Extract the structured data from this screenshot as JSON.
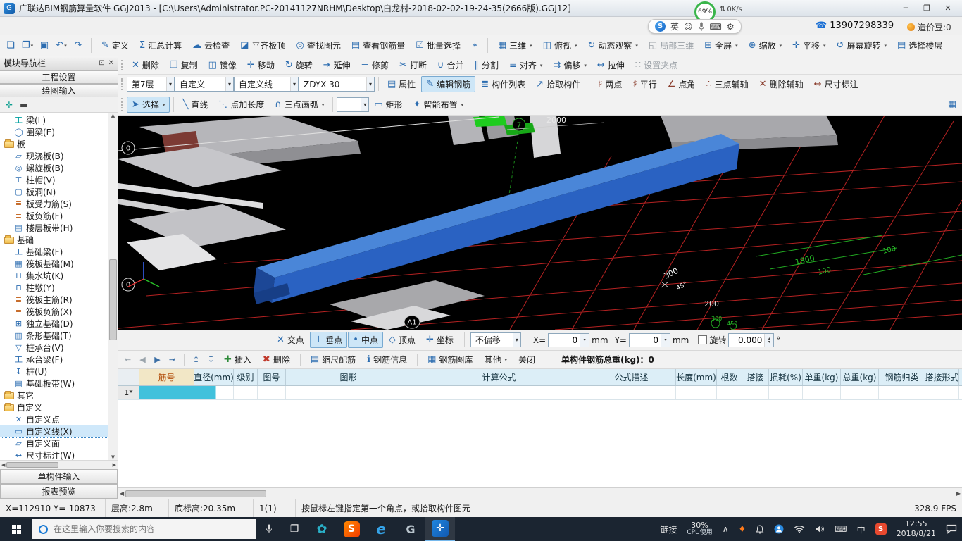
{
  "titlebar": {
    "app_glyph": "G",
    "title": "广联达BIM钢筋算量软件 GGJ2013 - [C:\\Users\\Administrator.PC-20141127NRHM\\Desktop\\白龙村-2018-02-02-19-24-35(2666版).GGJ12]",
    "minimize": "─",
    "maximize": "❐",
    "close": "✕"
  },
  "account_bar": {
    "battery": "69%",
    "net_speed": "0K/s",
    "ime": {
      "brand": "S",
      "lang": "英",
      "smiley": "☺",
      "keyboard": "⌨",
      "tool": "⚙"
    },
    "phone": "13907298339",
    "coins": "造价豆:0"
  },
  "toolbar_main": {
    "file_icons": [
      "❏",
      "❐",
      "▣",
      "↶",
      "↷"
    ],
    "buttons": [
      {
        "icon": "✎",
        "label": "定义"
      },
      {
        "icon": "Σ",
        "label": "汇总计算"
      },
      {
        "icon": "☁",
        "label": "云检查"
      },
      {
        "icon": "◪",
        "label": "平齐板顶"
      },
      {
        "icon": "◎",
        "label": "查找图元"
      },
      {
        "icon": "▤",
        "label": "查看钢筋量"
      },
      {
        "icon": "☑",
        "label": "批量选择"
      }
    ],
    "overflow": "»",
    "view_buttons": [
      {
        "icon": "▦",
        "label": "三维",
        "arrow": true
      },
      {
        "icon": "◫",
        "label": "俯视",
        "arrow": true
      },
      {
        "icon": "↻",
        "label": "动态观察",
        "arrow": true
      },
      {
        "icon": "◱",
        "label": "局部三维",
        "disabled": true
      },
      {
        "icon": "⊞",
        "label": "全屏",
        "arrow": true
      },
      {
        "icon": "⊕",
        "label": "缩放",
        "arrow": true
      },
      {
        "icon": "✛",
        "label": "平移",
        "arrow": true
      },
      {
        "icon": "↺",
        "label": "屏幕旋转",
        "arrow": true
      },
      {
        "icon": "▤",
        "label": "选择楼层"
      }
    ]
  },
  "toolbar_edit": {
    "buttons": [
      {
        "icon": "✕",
        "label": "删除"
      },
      {
        "icon": "❐",
        "label": "复制"
      },
      {
        "icon": "◫",
        "label": "镜像"
      },
      {
        "icon": "✛",
        "label": "移动"
      },
      {
        "icon": "↻",
        "label": "旋转"
      },
      {
        "icon": "⇥",
        "label": "延伸"
      },
      {
        "icon": "⊣",
        "label": "修剪"
      },
      {
        "icon": "✂",
        "label": "打断"
      },
      {
        "icon": "∪",
        "label": "合并"
      },
      {
        "icon": "∥",
        "label": "分割"
      },
      {
        "icon": "≡",
        "label": "对齐",
        "arrow": true
      },
      {
        "icon": "⇉",
        "label": "偏移",
        "arrow": true
      },
      {
        "icon": "↔",
        "label": "拉伸"
      },
      {
        "icon": "∷",
        "label": "设置夹点",
        "disabled": true
      }
    ]
  },
  "toolbar_element": {
    "floor_combo": "第7层",
    "category_combo": "自定义",
    "type_combo": "自定义线",
    "name_combo": "ZDYX-30",
    "buttons": [
      {
        "icon": "▤",
        "label": "属性"
      },
      {
        "icon": "✎",
        "label": "编辑钢筋",
        "pressed": true
      },
      {
        "icon": "≣",
        "label": "构件列表"
      },
      {
        "icon": "↗",
        "label": "拾取构件"
      }
    ],
    "aux_buttons": [
      {
        "icon": "♯",
        "label": "两点"
      },
      {
        "icon": "♯",
        "label": "平行"
      },
      {
        "icon": "∠",
        "label": "点角"
      },
      {
        "icon": "∴",
        "label": "三点辅轴"
      },
      {
        "icon": "✕",
        "label": "删除辅轴"
      },
      {
        "icon": "↔",
        "label": "尺寸标注"
      }
    ]
  },
  "toolbar_draw": {
    "select": {
      "icon": "➤",
      "label": "选择"
    },
    "buttons": [
      {
        "icon": "╲",
        "label": "直线"
      },
      {
        "icon": "⋱",
        "label": "点加长度"
      },
      {
        "icon": "∩",
        "label": "三点画弧",
        "arrow": true
      }
    ],
    "line_combo": "",
    "buttons2": [
      {
        "icon": "▭",
        "label": "矩形"
      },
      {
        "icon": "✦",
        "label": "智能布置",
        "arrow": true
      }
    ]
  },
  "sidebar": {
    "title": "模块导航栏",
    "project_settings": "工程设置",
    "draw_input": "绘图输入",
    "tree": [
      {
        "label": "梁(L)",
        "level": 1,
        "icon": "工",
        "c": "#00a0a0"
      },
      {
        "label": "圈梁(E)",
        "level": 1,
        "icon": "◯",
        "c": "#2b6cb0"
      },
      {
        "label": "板",
        "level": 0,
        "folder": true
      },
      {
        "label": "现浇板(B)",
        "level": 1,
        "icon": "▱",
        "c": "#2b6cb0"
      },
      {
        "label": "螺旋板(B)",
        "level": 1,
        "icon": "◎",
        "c": "#2b6cb0"
      },
      {
        "label": "柱帽(V)",
        "level": 1,
        "icon": "⊤",
        "c": "#2b6cb0"
      },
      {
        "label": "板洞(N)",
        "level": 1,
        "icon": "▢",
        "c": "#2b6cb0"
      },
      {
        "label": "板受力筋(S)",
        "level": 1,
        "icon": "≣",
        "c": "#c05a10"
      },
      {
        "label": "板负筋(F)",
        "level": 1,
        "icon": "≡",
        "c": "#c05a10"
      },
      {
        "label": "楼层板带(H)",
        "level": 1,
        "icon": "▤",
        "c": "#2b6cb0"
      },
      {
        "label": "基础",
        "level": 0,
        "folder": true
      },
      {
        "label": "基础梁(F)",
        "level": 1,
        "icon": "工",
        "c": "#2b6cb0"
      },
      {
        "label": "筏板基础(M)",
        "level": 1,
        "icon": "▦",
        "c": "#2b6cb0"
      },
      {
        "label": "集水坑(K)",
        "level": 1,
        "icon": "⊔",
        "c": "#2b6cb0"
      },
      {
        "label": "柱墩(Y)",
        "level": 1,
        "icon": "⊓",
        "c": "#2b6cb0"
      },
      {
        "label": "筏板主筋(R)",
        "level": 1,
        "icon": "≣",
        "c": "#c05a10"
      },
      {
        "label": "筏板负筋(X)",
        "level": 1,
        "icon": "≡",
        "c": "#c05a10"
      },
      {
        "label": "独立基础(D)",
        "level": 1,
        "icon": "⊞",
        "c": "#2b6cb0"
      },
      {
        "label": "条形基础(T)",
        "level": 1,
        "icon": "▥",
        "c": "#2b6cb0"
      },
      {
        "label": "桩承台(V)",
        "level": 1,
        "icon": "▽",
        "c": "#2b6cb0"
      },
      {
        "label": "承台梁(F)",
        "level": 1,
        "icon": "工",
        "c": "#2b6cb0"
      },
      {
        "label": "桩(U)",
        "level": 1,
        "icon": "↧",
        "c": "#2b6cb0"
      },
      {
        "label": "基础板带(W)",
        "level": 1,
        "icon": "▤",
        "c": "#2b6cb0"
      },
      {
        "label": "其它",
        "level": 0,
        "folder": true
      },
      {
        "label": "自定义",
        "level": 0,
        "folder": true
      },
      {
        "label": "自定义点",
        "level": 1,
        "icon": "✕",
        "c": "#2b6cb0"
      },
      {
        "label": "自定义线(X)",
        "level": 1,
        "icon": "▭",
        "c": "#2b6cb0",
        "selected": true
      },
      {
        "label": "自定义面",
        "level": 1,
        "icon": "▱",
        "c": "#2b6cb0"
      },
      {
        "label": "尺寸标注(W)",
        "level": 1,
        "icon": "↔",
        "c": "#2b6cb0"
      }
    ],
    "single_member": "单构件输入",
    "report_preview": "报表预览"
  },
  "viewport": {
    "axis_labels": {
      "a0_top": "0",
      "a0_bottom": "0",
      "g7": "7",
      "a1": "A1"
    },
    "dims": {
      "d2000": "2000",
      "d300": "300",
      "d45": "45°",
      "d200": "200",
      "d1800": "1800",
      "d100a": "100",
      "d100b": "100",
      "d300g": "300",
      "d450g": "450"
    }
  },
  "snap_bar": {
    "buttons": [
      {
        "icon": "✕",
        "label": "交点"
      },
      {
        "icon": "⊥",
        "label": "垂点",
        "pressed": true
      },
      {
        "icon": "•",
        "label": "中点",
        "pressed": true
      },
      {
        "icon": "◇",
        "label": "顶点"
      },
      {
        "icon": "✛",
        "label": "坐标"
      }
    ],
    "offset_combo": "不偏移",
    "x_label": "X=",
    "x_value": "0",
    "x_unit": "mm",
    "y_label": "Y=",
    "y_value": "0",
    "y_unit": "mm",
    "rotate_label": "旋转",
    "rotate_value": "0.000",
    "rotate_unit": "°"
  },
  "table": {
    "toolbar": {
      "insert": "插入",
      "delete": "删除",
      "scale_rebar": "缩尺配筋",
      "rebar_info": "钢筋信息",
      "rebar_library": "钢筋图库",
      "other": "其他",
      "close": "关闭",
      "total": "单构件钢筋总重(kg)：0"
    },
    "headers": [
      "筋号",
      "直径(mm)",
      "级别",
      "图号",
      "图形",
      "计算公式",
      "公式描述",
      "长度(mm)",
      "根数",
      "搭接",
      "损耗(%)",
      "单重(kg)",
      "总重(kg)",
      "钢筋归类",
      "搭接形式"
    ],
    "rows": [
      {
        "num": "1*"
      }
    ]
  },
  "status_bar": {
    "coords": "X=112910 Y=-10873",
    "floor_height": "层高:2.8m",
    "base_elev": "底标高:20.35m",
    "selection": "1(1)",
    "hint": "按鼠标左键指定第一个角点，或拾取构件图元",
    "fps": "328.9 FPS"
  },
  "taskbar": {
    "search_placeholder": "在这里输入你要搜索的内容",
    "link_label": "链接",
    "cpu_percent": "30%",
    "cpu_label": "CPU使用",
    "ime_indicator": "中",
    "time": "12:55",
    "date": "2018/8/21"
  }
}
